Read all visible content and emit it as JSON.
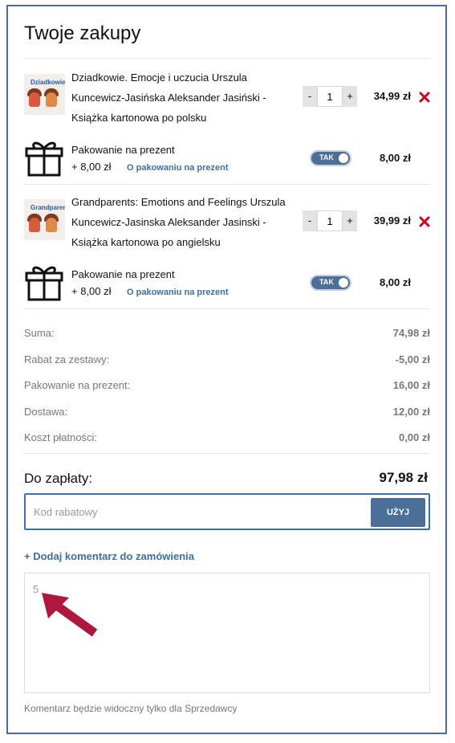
{
  "cart": {
    "title": "Twoje zakupy",
    "items": [
      {
        "name_lines": [
          "Dziadkowie. Emocje i uczucia Urszula",
          "Kuncewicz-Jasińska Aleksander Jasiński -",
          "Książka kartonowa po polsku"
        ],
        "thumb_title": "Dziadkowie",
        "qty": "1",
        "minus": "-",
        "plus": "+",
        "price": "34,99 zł",
        "gift": {
          "title": "Pakowanie na prezent",
          "extra": "+ 8,00 zł",
          "link": "O pakowaniu na prezent",
          "toggle": "TAK",
          "price": "8,00 zł"
        }
      },
      {
        "name_lines": [
          "Grandparents: Emotions and Feelings Urszula",
          "Kuncewicz-Jasinska Aleksander Jasinski -",
          "Książka kartonowa po angielsku"
        ],
        "thumb_title": "Grandparents",
        "qty": "1",
        "minus": "-",
        "plus": "+",
        "price": "39,99 zł",
        "gift": {
          "title": "Pakowanie na prezent",
          "extra": "+ 8,00 zł",
          "link": "O pakowaniu na prezent",
          "toggle": "TAK",
          "price": "8,00 zł"
        }
      }
    ]
  },
  "summary": [
    {
      "label": "Suma:",
      "value": "74,98 zł"
    },
    {
      "label": "Rabat za zestawy:",
      "value": "-5,00 zł"
    },
    {
      "label": "Pakowanie na prezent:",
      "value": "16,00 zł"
    },
    {
      "label": "Dostawa:",
      "value": "12,00 zł"
    },
    {
      "label": "Koszt płatności:",
      "value": "0,00 zł"
    }
  ],
  "total": {
    "label": "Do zapłaty:",
    "value": "97,98 zł"
  },
  "coupon": {
    "placeholder": "Kod rabatowy",
    "value": "",
    "apply_label": "UŻYJ"
  },
  "comment": {
    "add_label": "+ Dodaj komentarz do zamówienia",
    "value": "5",
    "note": "Komentarz będzie widoczny tylko dla Sprzedawcy"
  },
  "colors": {
    "accent": "#4b6f98",
    "link": "#3e6ea6",
    "remove": "#d0021b",
    "arrow": "#b0173c"
  },
  "icons": [
    "gift-icon",
    "remove-icon",
    "arrow-annotation"
  ]
}
